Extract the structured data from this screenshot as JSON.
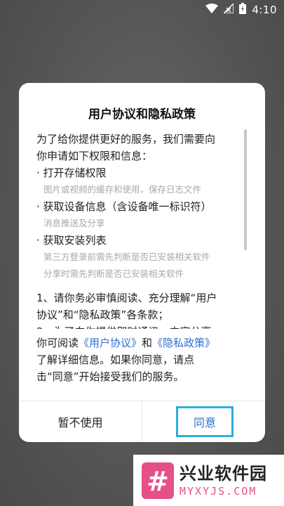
{
  "status_bar": {
    "time": "4:10",
    "icons": [
      "wifi-icon",
      "no-signal-icon",
      "battery-icon"
    ]
  },
  "dialog": {
    "title": "用户协议和隐私政策",
    "intro_line1": "为了给你提供更好的服务，我们需要向",
    "intro_line2": "你申请如下权限和信息：",
    "permissions": [
      {
        "title": "· 打开存储权限",
        "desc": [
          "图片或视频的缓存和使用，保存日志文件"
        ]
      },
      {
        "title": "· 获取设备信息（含设备唯一标识符）",
        "desc": [
          "消息推送及分享"
        ]
      },
      {
        "title": "· 获取安装列表",
        "desc": [
          "第三方登录前需先判断是否已安装相关软件",
          "分享时需先判断是否已安装相关软件"
        ]
      }
    ],
    "note1_line1": "1、请你务必审慎阅读、充分理解“用户",
    "note1_line2": "协议”和“隐私政策”各条款；",
    "note2_partial": "2、为了向你提供即时通讯、内容分享",
    "bottom": {
      "prefix": "你可阅读",
      "link_user_agreement": "《用户协议》",
      "and": "和",
      "link_privacy_policy": "《隐私政策》",
      "line2": "了解详细信息。如果你同意，请点",
      "line3": "击“同意”开始接受我们的服务。"
    },
    "buttons": {
      "cancel": "暂不使用",
      "agree": "同意"
    }
  },
  "watermark": {
    "name": "兴业软件园",
    "domain": "MYXYJS.COM",
    "logo_glyph": "#"
  },
  "colors": {
    "link": "#2e6fd0",
    "agree_border": "#2ab0e0",
    "watermark_pink": "#e4508a"
  }
}
